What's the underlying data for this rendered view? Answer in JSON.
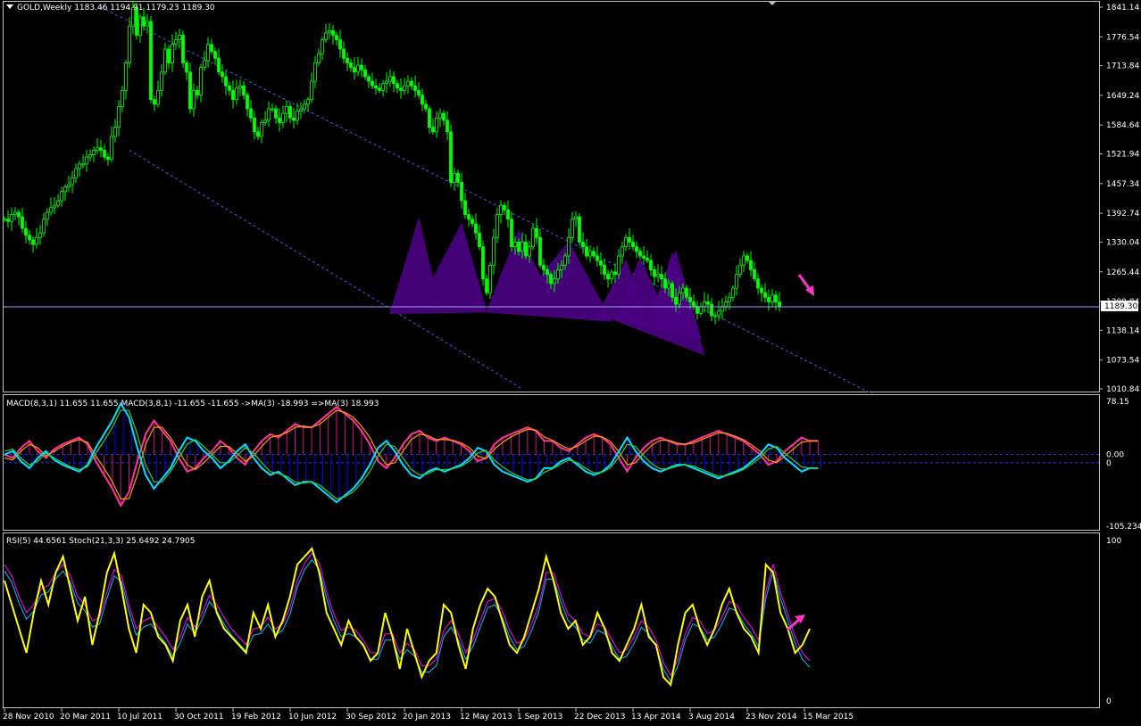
{
  "colors": {
    "background": "#000000",
    "frame": "#c0c0c0",
    "candle": "#00ff00",
    "channel": "#5050ff",
    "pattern_fill": "#4b0082",
    "price_line": "#a0a0ff",
    "macd_main": "#ff3399",
    "macd_signal": "#ff9900",
    "macd_hist_pos": "#c71585",
    "macd_hist_neg": "#0000ff",
    "macd2_main": "#00e0ff",
    "macd2_signal": "#33cc33",
    "rsi": "#ffff00",
    "stoch_main": "#00bfff",
    "stoch_signal": "#ff00ff",
    "arrow": "#ff33cc"
  },
  "header": {
    "price": "GOLD,Weekly  1183.46 1194.91 1179.23 1189.30",
    "macd": "MACD(8,3,1) 11.655 11.655  MACD(3,8,1) -11.655 -11.655  ->MA(3) -18.993  =>MA(3) 18.993",
    "rsi": "RSI(5) 44.6561  Stoch(21,3,3) 25.6492 24.7905"
  },
  "current_price_label": "1189.30",
  "chart_data": [
    {
      "type": "candlestick",
      "name": "GOLD,Weekly",
      "ohlc_last": {
        "open": 1183.46,
        "high": 1194.91,
        "low": 1179.23,
        "close": 1189.3
      },
      "y_ticks": [
        "1841.14",
        "1776.54",
        "1713.84",
        "1649.24",
        "1584.64",
        "1521.94",
        "1457.34",
        "1392.74",
        "1330.04",
        "1265.44",
        "1200.84",
        "1138.14",
        "1073.54",
        "1010.84"
      ],
      "ylim": [
        1010.84,
        1841.14
      ],
      "x_ticks": [
        "28 Nov 2010",
        "20 Mar 2011",
        "10 Jul 2011",
        "30 Oct 2011",
        "19 Feb 2012",
        "10 Jun 2012",
        "30 Sep 2012",
        "20 Jan 2013",
        "12 May 2013",
        "1 Sep 2013",
        "22 Dec 2013",
        "13 Apr 2014",
        "3 Aug 2014",
        "23 Nov 2014",
        "15 Mar 2015"
      ],
      "x_tick_index": [
        0,
        16,
        32,
        48,
        64,
        80,
        96,
        112,
        128,
        144,
        160,
        176,
        192,
        208,
        224
      ],
      "closes": [
        1380,
        1375,
        1390,
        1395,
        1385,
        1360,
        1345,
        1335,
        1325,
        1340,
        1350,
        1380,
        1395,
        1405,
        1410,
        1420,
        1440,
        1450,
        1455,
        1470,
        1490,
        1500,
        1500,
        1515,
        1520,
        1530,
        1535,
        1530,
        1515,
        1510,
        1560,
        1580,
        1625,
        1660,
        1720,
        1800,
        1840,
        1780,
        1820,
        1800,
        1810,
        1640,
        1630,
        1660,
        1700,
        1750,
        1720,
        1760,
        1770,
        1780,
        1720,
        1700,
        1620,
        1660,
        1650,
        1710,
        1725,
        1760,
        1745,
        1730,
        1700,
        1690,
        1670,
        1660,
        1640,
        1665,
        1670,
        1650,
        1620,
        1600,
        1570,
        1560,
        1590,
        1595,
        1620,
        1620,
        1600,
        1590,
        1610,
        1625,
        1600,
        1595,
        1615,
        1620,
        1630,
        1640,
        1680,
        1720,
        1740,
        1770,
        1785,
        1790,
        1780,
        1770,
        1750,
        1730,
        1720,
        1710,
        1700,
        1715,
        1705,
        1690,
        1680,
        1670,
        1665,
        1660,
        1675,
        1680,
        1690,
        1675,
        1665,
        1660,
        1670,
        1680,
        1670,
        1660,
        1650,
        1630,
        1620,
        1580,
        1570,
        1600,
        1610,
        1595,
        1570,
        1460,
        1480,
        1460,
        1420,
        1390,
        1380,
        1370,
        1350,
        1320,
        1250,
        1220,
        1280,
        1340,
        1390,
        1410,
        1400,
        1380,
        1320,
        1330,
        1310,
        1330,
        1300,
        1320,
        1360,
        1340,
        1280,
        1270,
        1260,
        1240,
        1250,
        1270,
        1280,
        1300,
        1340,
        1380,
        1385,
        1330,
        1320,
        1300,
        1310,
        1300,
        1290,
        1280,
        1260,
        1250,
        1265,
        1260,
        1300,
        1320,
        1340,
        1330,
        1320,
        1310,
        1300,
        1295,
        1290,
        1270,
        1255,
        1260,
        1250,
        1230,
        1240,
        1210,
        1195,
        1220,
        1230,
        1210,
        1200,
        1190,
        1175,
        1190,
        1200,
        1195,
        1170,
        1170,
        1180,
        1190,
        1200,
        1210,
        1230,
        1260,
        1280,
        1300,
        1290,
        1270,
        1250,
        1230,
        1220,
        1210,
        1200,
        1215,
        1200,
        1189.3
      ],
      "channel": [
        {
          "name": "upper",
          "points": [
            [
              27,
              1841.14
            ],
            [
              243,
              1000
            ]
          ]
        },
        {
          "name": "lower",
          "points": [
            [
              35,
              1530
            ],
            [
              145,
              1010.84
            ]
          ]
        }
      ],
      "patterns": [
        {
          "points": [
            [
              108,
              1175
            ],
            [
              116,
              1380
            ],
            [
              120,
              1250
            ],
            [
              128,
              1370
            ],
            [
              135,
              1178
            ]
          ]
        },
        {
          "points": [
            [
              135,
              1178
            ],
            [
              144,
              1355
            ],
            [
              150,
              1255
            ],
            [
              158,
              1330
            ],
            [
              170,
              1158
            ]
          ]
        },
        {
          "points": [
            [
              171,
              1160
            ],
            [
              178,
              1295
            ],
            [
              183,
              1210
            ],
            [
              187,
              1305
            ],
            [
              196,
              1085
            ]
          ]
        },
        {
          "points": [
            [
              166,
              1170
            ],
            [
              174,
              1290
            ],
            [
              180,
              1160
            ],
            [
              188,
              1310
            ],
            [
              195,
              1120
            ]
          ]
        }
      ]
    },
    {
      "type": "line",
      "name": "MACD",
      "y_ticks": [
        "78.15",
        "0.00",
        "0",
        "-105.234"
      ],
      "ylim": [
        -105.234,
        78.15
      ],
      "series": [
        {
          "values": [
            0,
            -5,
            10,
            20,
            5,
            -5,
            8,
            15,
            20,
            25,
            15,
            -10,
            -30,
            -50,
            -75,
            -55,
            -10,
            30,
            50,
            35,
            20,
            -5,
            -25,
            -20,
            -5,
            5,
            20,
            10,
            -5,
            -15,
            5,
            20,
            30,
            25,
            35,
            45,
            40,
            40,
            50,
            60,
            70,
            60,
            50,
            35,
            15,
            -10,
            -20,
            -5,
            15,
            30,
            35,
            25,
            20,
            25,
            20,
            15,
            5,
            -10,
            -5,
            15,
            25,
            30,
            35,
            40,
            35,
            20,
            20,
            10,
            5,
            15,
            25,
            30,
            25,
            15,
            -5,
            -25,
            -5,
            10,
            20,
            25,
            20,
            15,
            15,
            20,
            25,
            30,
            35,
            30,
            25,
            20,
            10,
            0,
            -15,
            -10,
            5,
            15,
            25,
            20,
            20
          ]
        },
        {
          "values": [
            -5,
            -8,
            5,
            15,
            10,
            -2,
            5,
            12,
            18,
            22,
            18,
            -2,
            -20,
            -40,
            -65,
            -65,
            -30,
            15,
            40,
            40,
            25,
            5,
            -15,
            -22,
            -12,
            0,
            12,
            12,
            2,
            -10,
            -2,
            12,
            25,
            28,
            32,
            40,
            42,
            40,
            45,
            55,
            65,
            62,
            55,
            42,
            25,
            2,
            -15,
            -12,
            5,
            22,
            30,
            28,
            22,
            22,
            21,
            17,
            10,
            -2,
            -6,
            8,
            18,
            26,
            32,
            37,
            36,
            26,
            21,
            14,
            8,
            12,
            20,
            27,
            26,
            19,
            4,
            -15,
            -12,
            2,
            14,
            21,
            21,
            17,
            15,
            17,
            22,
            27,
            32,
            31,
            27,
            22,
            14,
            5,
            -8,
            -12,
            -2,
            8,
            18,
            20,
            20
          ]
        }
      ]
    },
    {
      "type": "line",
      "name": "RSI / Stoch",
      "y_ticks": [
        "100",
        "0"
      ],
      "ylim": [
        0,
        100
      ],
      "series": [
        {
          "values": [
            75,
            60,
            45,
            30,
            55,
            75,
            60,
            80,
            90,
            70,
            50,
            65,
            35,
            55,
            80,
            92,
            70,
            45,
            30,
            60,
            55,
            40,
            35,
            25,
            50,
            60,
            40,
            65,
            75,
            55,
            45,
            40,
            35,
            30,
            55,
            45,
            60,
            40,
            50,
            65,
            85,
            90,
            95,
            80,
            55,
            45,
            35,
            50,
            40,
            35,
            25,
            30,
            55,
            40,
            20,
            45,
            30,
            15,
            25,
            30,
            60,
            55,
            35,
            20,
            45,
            60,
            70,
            65,
            50,
            35,
            30,
            40,
            55,
            70,
            90,
            75,
            55,
            45,
            50,
            35,
            40,
            55,
            45,
            30,
            25,
            35,
            45,
            60,
            40,
            35,
            15,
            10,
            35,
            55,
            60,
            45,
            35,
            45,
            60,
            70,
            55,
            45,
            40,
            30,
            85,
            80,
            55,
            45,
            30,
            35,
            45
          ]
        },
        {
          "values": [
            85,
            78,
            65,
            55,
            60,
            70,
            72,
            80,
            85,
            78,
            65,
            60,
            50,
            52,
            68,
            82,
            78,
            60,
            45,
            50,
            52,
            46,
            40,
            32,
            40,
            52,
            46,
            55,
            66,
            60,
            52,
            45,
            40,
            35,
            45,
            46,
            52,
            45,
            48,
            58,
            75,
            86,
            92,
            86,
            68,
            54,
            44,
            46,
            44,
            38,
            30,
            30,
            42,
            42,
            30,
            36,
            32,
            22,
            22,
            26,
            44,
            50,
            42,
            30,
            38,
            50,
            62,
            64,
            56,
            44,
            36,
            38,
            48,
            60,
            80,
            80,
            66,
            54,
            50,
            42,
            40,
            48,
            46,
            38,
            30,
            32,
            40,
            50,
            46,
            38,
            24,
            16,
            26,
            42,
            52,
            50,
            42,
            44,
            52,
            62,
            60,
            52,
            46,
            38,
            68,
            85,
            68,
            54,
            40,
            30,
            25
          ]
        }
      ]
    }
  ]
}
